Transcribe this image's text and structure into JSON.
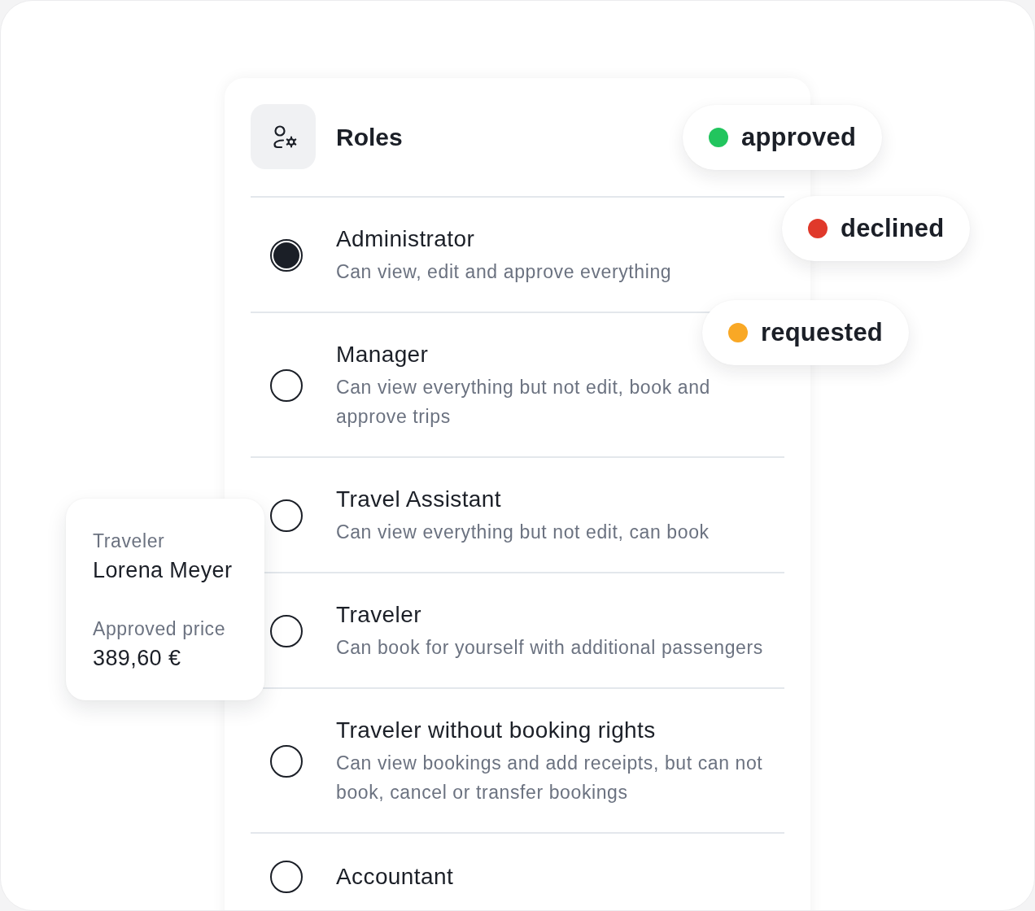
{
  "header": {
    "title": "Roles"
  },
  "roles": [
    {
      "name": "Administrator",
      "description": "Can view, edit and approve everything",
      "selected": true
    },
    {
      "name": "Manager",
      "description": "Can view everything but not edit, book and approve trips",
      "selected": false
    },
    {
      "name": "Travel Assistant",
      "description": "Can view everything but not edit, can book",
      "selected": false
    },
    {
      "name": "Traveler",
      "description": "Can book for yourself with additional passengers",
      "selected": false
    },
    {
      "name": "Traveler without booking rights",
      "description": "Can view bookings and add receipts, but can not book, cancel or transfer bookings",
      "selected": false
    },
    {
      "name": "Accountant",
      "selected": false
    }
  ],
  "status_pills": [
    {
      "label": "approved",
      "color": "#22c55e"
    },
    {
      "label": "declined",
      "color": "#e0392b"
    },
    {
      "label": "requested",
      "color": "#f9a825"
    }
  ],
  "traveler_card": {
    "fields": [
      {
        "label": "Traveler",
        "value": "Lorena Meyer"
      },
      {
        "label": "Approved price",
        "value": "389,60 €"
      }
    ]
  }
}
